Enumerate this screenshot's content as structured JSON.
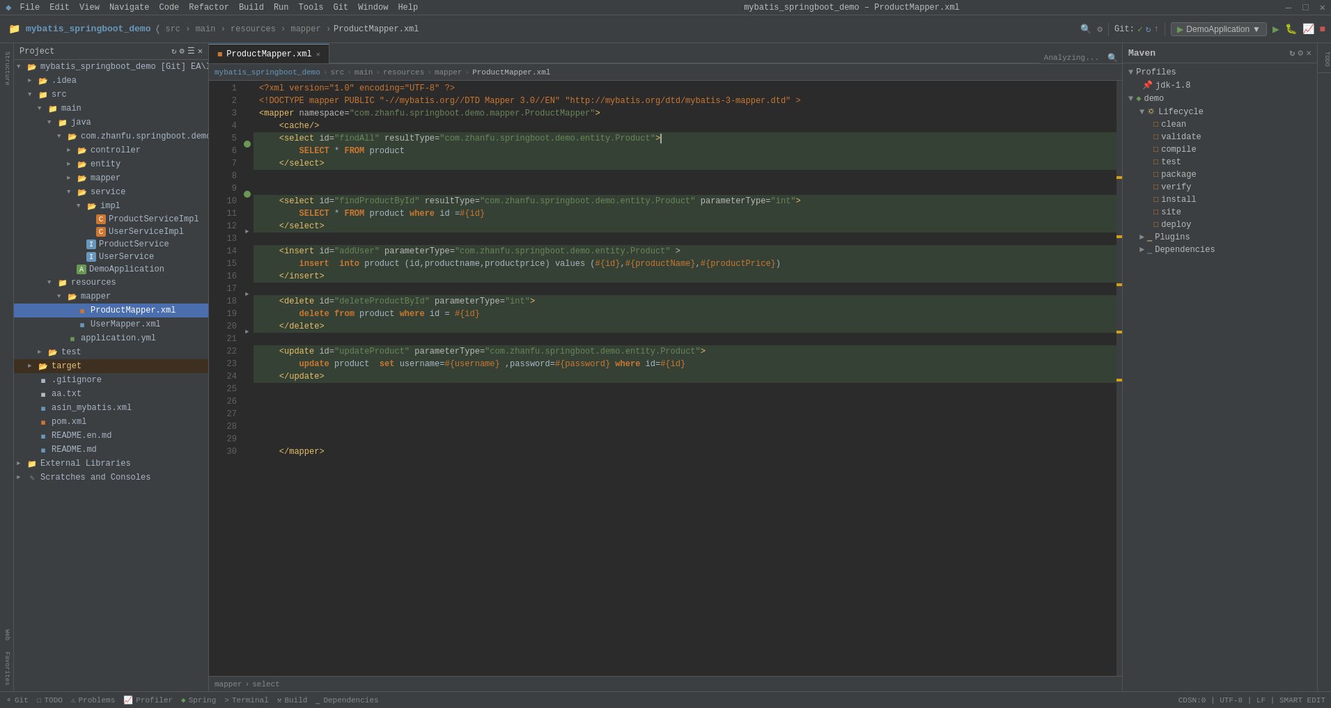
{
  "titleBar": {
    "appName": "mybatis_springboot_demo",
    "menuItems": [
      "File",
      "Edit",
      "View",
      "Navigate",
      "Code",
      "Refactor",
      "Build",
      "Run",
      "Tools",
      "Git",
      "Window",
      "Help"
    ],
    "title": "mybatis_springboot_demo – ProductMapper.xml"
  },
  "breadcrumb": {
    "parts": [
      "mybatis_springboot_demo",
      "src",
      "main",
      "resources",
      "mapper",
      "ProductMapper.xml"
    ]
  },
  "tabs": [
    {
      "label": "ProductMapper.xml",
      "active": true
    }
  ],
  "sidebar": {
    "title": "Project",
    "items": [
      {
        "level": 0,
        "label": "mybatis_springboot_demo [Git]",
        "indent": 0,
        "type": "project",
        "expanded": true
      },
      {
        "level": 1,
        "label": ".idea",
        "indent": 1,
        "type": "folder"
      },
      {
        "level": 1,
        "label": "src",
        "indent": 1,
        "type": "folder",
        "expanded": true
      },
      {
        "level": 2,
        "label": "main",
        "indent": 2,
        "type": "folder",
        "expanded": true
      },
      {
        "level": 3,
        "label": "java",
        "indent": 3,
        "type": "folder-blue",
        "expanded": true
      },
      {
        "level": 4,
        "label": "com.zhanfu.springboot.demo",
        "indent": 4,
        "type": "folder",
        "expanded": true
      },
      {
        "level": 5,
        "label": "controller",
        "indent": 5,
        "type": "folder"
      },
      {
        "level": 5,
        "label": "entity",
        "indent": 5,
        "type": "folder"
      },
      {
        "level": 5,
        "label": "mapper",
        "indent": 5,
        "type": "folder"
      },
      {
        "level": 5,
        "label": "service",
        "indent": 5,
        "type": "folder",
        "expanded": true
      },
      {
        "level": 6,
        "label": "impl",
        "indent": 6,
        "type": "folder",
        "expanded": true
      },
      {
        "level": 7,
        "label": "ProductServiceImpl",
        "indent": 7,
        "type": "java-class"
      },
      {
        "level": 7,
        "label": "UserServiceImpl",
        "indent": 7,
        "type": "java-class"
      },
      {
        "level": 6,
        "label": "ProductService",
        "indent": 6,
        "type": "java-interface"
      },
      {
        "level": 6,
        "label": "UserService",
        "indent": 6,
        "type": "java-interface"
      },
      {
        "level": 5,
        "label": "DemoApplication",
        "indent": 5,
        "type": "java-app"
      },
      {
        "level": 3,
        "label": "resources",
        "indent": 3,
        "type": "folder-blue",
        "expanded": true
      },
      {
        "level": 4,
        "label": "mapper",
        "indent": 4,
        "type": "folder",
        "expanded": true
      },
      {
        "level": 5,
        "label": "ProductMapper.xml",
        "indent": 5,
        "type": "xml",
        "selected": true
      },
      {
        "level": 5,
        "label": "UserMapper.xml",
        "indent": 5,
        "type": "xml"
      },
      {
        "level": 4,
        "label": "application.yml",
        "indent": 4,
        "type": "yml"
      },
      {
        "level": 2,
        "label": "test",
        "indent": 2,
        "type": "folder"
      },
      {
        "level": 1,
        "label": "target",
        "indent": 1,
        "type": "folder-orange"
      },
      {
        "level": 1,
        "label": ".gitignore",
        "indent": 1,
        "type": "git"
      },
      {
        "level": 1,
        "label": "aa.txt",
        "indent": 1,
        "type": "txt"
      },
      {
        "level": 1,
        "label": "asin_mybatis.xml",
        "indent": 1,
        "type": "xml"
      },
      {
        "level": 1,
        "label": "pom.xml",
        "indent": 1,
        "type": "xml-blue"
      },
      {
        "level": 1,
        "label": "README.en.md",
        "indent": 1,
        "type": "md"
      },
      {
        "level": 1,
        "label": "README.md",
        "indent": 1,
        "type": "md"
      },
      {
        "level": 0,
        "label": "External Libraries",
        "indent": 0,
        "type": "folder"
      },
      {
        "level": 0,
        "label": "Scratches and Consoles",
        "indent": 0,
        "type": "scratch"
      }
    ]
  },
  "codeLines": [
    {
      "num": 1,
      "content": "<?xml version=\"1.0\" encoding=\"UTF-8\" ?>",
      "type": "xml-decl"
    },
    {
      "num": 2,
      "content": "<!DOCTYPE mapper PUBLIC \"-//mybatis.org//DTD Mapper 3.0//EN\" \"http://mybatis.org/dtd/mybatis-3-mapper.dtd\" >",
      "type": "doctype"
    },
    {
      "num": 3,
      "content": "<mapper namespace=\"com.zhanfu.springboot.demo.mapper.ProductMapper\">",
      "type": "tag"
    },
    {
      "num": 4,
      "content": "    <cache/>",
      "type": "tag"
    },
    {
      "num": 5,
      "content": "    <select id=\"findAll\" resultType=\"com.zhanfu.springboot.demo.entity.Product\">",
      "type": "tag-highlighted"
    },
    {
      "num": 6,
      "content": "        SELECT * FROM product",
      "type": "sql-highlighted"
    },
    {
      "num": 7,
      "content": "    </select>",
      "type": "tag-highlighted"
    },
    {
      "num": 8,
      "content": "",
      "type": "empty"
    },
    {
      "num": 9,
      "content": "",
      "type": "empty"
    },
    {
      "num": 10,
      "content": "    <select id=\"findProductById\" resultType=\"com.zhanfu.springboot.demo.entity.Product\" parameterType=\"int\">",
      "type": "tag-highlighted"
    },
    {
      "num": 11,
      "content": "        SELECT * FROM product where id =#{id}",
      "type": "sql-highlighted"
    },
    {
      "num": 12,
      "content": "    </select>",
      "type": "tag-highlighted"
    },
    {
      "num": 13,
      "content": "",
      "type": "empty"
    },
    {
      "num": 14,
      "content": "    <insert id=\"addUser\" parameterType=\"com.zhanfu.springboot.demo.entity.Product\" >",
      "type": "tag-highlighted"
    },
    {
      "num": 15,
      "content": "        insert  into product (id,productname,productprice) values (#{id},#{productName},#{productPrice})",
      "type": "sql-highlighted"
    },
    {
      "num": 16,
      "content": "    </insert>",
      "type": "tag-highlighted"
    },
    {
      "num": 17,
      "content": "",
      "type": "empty"
    },
    {
      "num": 18,
      "content": "    <delete id=\"deleteProductById\" parameterType=\"int\">",
      "type": "tag-highlighted"
    },
    {
      "num": 19,
      "content": "        delete from product where id = #{id}",
      "type": "sql-highlighted"
    },
    {
      "num": 20,
      "content": "    </delete>",
      "type": "tag-highlighted"
    },
    {
      "num": 21,
      "content": "",
      "type": "empty"
    },
    {
      "num": 22,
      "content": "    <update id=\"updateProduct\" parameterType=\"com.zhanfu.springboot.demo.entity.Product\">",
      "type": "tag-highlighted"
    },
    {
      "num": 23,
      "content": "        update product  set username=#{username} ,password=#{password} where id=#{id}",
      "type": "sql-highlighted"
    },
    {
      "num": 24,
      "content": "    </update>",
      "type": "tag-highlighted"
    },
    {
      "num": 25,
      "content": "",
      "type": "empty"
    },
    {
      "num": 26,
      "content": "",
      "type": "empty"
    },
    {
      "num": 27,
      "content": "",
      "type": "empty"
    },
    {
      "num": 28,
      "content": "",
      "type": "empty"
    },
    {
      "num": 29,
      "content": "",
      "type": "empty"
    },
    {
      "num": 30,
      "content": "    </mapper>",
      "type": "tag"
    }
  ],
  "editorBottomBreadcrumb": {
    "parts": [
      "mapper",
      "select"
    ]
  },
  "maven": {
    "title": "Maven",
    "profiles": {
      "label": "Profiles",
      "jdk18": "jdk-1.8"
    },
    "demo": {
      "label": "demo",
      "lifecycle": {
        "label": "Lifecycle",
        "items": [
          "clean",
          "validate",
          "compile",
          "test",
          "package",
          "verify",
          "install",
          "site",
          "deploy"
        ]
      },
      "plugins": "Plugins",
      "dependencies": "Dependencies"
    }
  },
  "statusBar": {
    "git": "Git",
    "todo": "TODO",
    "problems": "Problems",
    "profiler": "Profiler",
    "spring": "Spring",
    "terminal": "Terminal",
    "build": "Build",
    "dependencies": "Dependencies",
    "rightInfo": "CDSN:0 | UTF-8 | LF | SMART EDIT"
  },
  "analyzing": "Analyzing..."
}
